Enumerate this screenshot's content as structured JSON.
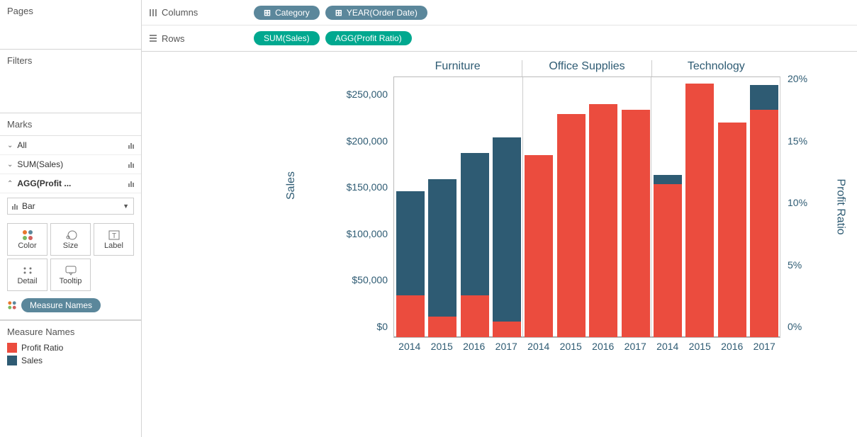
{
  "panels": {
    "pages_title": "Pages",
    "filters_title": "Filters",
    "marks_title": "Marks",
    "all_label": "All",
    "sum_sales_label": "SUM(Sales)",
    "agg_profit_label": "AGG(Profit ...",
    "mark_type": "Bar",
    "encodings": {
      "color": "Color",
      "size": "Size",
      "label": "Label",
      "detail": "Detail",
      "tooltip": "Tooltip"
    },
    "measure_names_pill": "Measure Names",
    "measure_names_title": "Measure Names",
    "legend_profit": "Profit Ratio",
    "legend_sales": "Sales"
  },
  "shelves": {
    "columns_label": "Columns",
    "rows_label": "Rows",
    "column_pills": [
      "Category",
      "YEAR(Order Date)"
    ],
    "row_pills": [
      "SUM(Sales)",
      "AGG(Profit Ratio)"
    ]
  },
  "colors": {
    "sales": "#2e5b73",
    "profit": "#eb4c3e"
  },
  "chart_data": {
    "type": "bar",
    "categories": [
      "Furniture",
      "Office Supplies",
      "Technology"
    ],
    "years": [
      "2014",
      "2015",
      "2016",
      "2017"
    ],
    "y_left_label": "Sales",
    "y_right_label": "Profit Ratio",
    "y_left_ticks": [
      0,
      50000,
      100000,
      150000,
      200000,
      250000
    ],
    "y_left_tick_labels": [
      "$0",
      "$50,000",
      "$100,000",
      "$150,000",
      "$200,000",
      "$250,000"
    ],
    "y_right_ticks": [
      0,
      5,
      10,
      15,
      20
    ],
    "y_right_tick_labels": [
      "0%",
      "5%",
      "10%",
      "15%",
      "20%"
    ],
    "y_left_max": 280000,
    "y_right_max": 21,
    "series": [
      {
        "name": "Sales",
        "axis": "left",
        "data": {
          "Furniture": {
            "2014": 157000,
            "2015": 170000,
            "2016": 198000,
            "2017": 215000
          },
          "Office Supplies": {
            "2014": 0,
            "2015": 0,
            "2016": 0,
            "2017": 0
          },
          "Technology": {
            "2014": 175000,
            "2015": 0,
            "2016": 0,
            "2017": 272000
          }
        },
        "note": "Dark bars; where bar not visible behind red, sales equals profit-ratio bar height visually (drawn underneath)"
      },
      {
        "name": "Profit Ratio",
        "axis": "right",
        "data": {
          "Furniture": {
            "2014": 3.5,
            "2015": 1.8,
            "2016": 3.4,
            "2017": 1.4
          },
          "Office Supplies": {
            "2014": 14.7,
            "2015": 18.0,
            "2016": 18.8,
            "2017": 18.4
          },
          "Technology": {
            "2014": 12.5,
            "2015": 20.5,
            "2016": 17.4,
            "2017": 18.4
          }
        }
      }
    ],
    "visual_bars": [
      {
        "cat": "Furniture",
        "year": "2014",
        "sales_h": 157000,
        "profit_h": 45000
      },
      {
        "cat": "Furniture",
        "year": "2015",
        "sales_h": 170000,
        "profit_h": 22000
      },
      {
        "cat": "Furniture",
        "year": "2016",
        "sales_h": 198000,
        "profit_h": 45000
      },
      {
        "cat": "Furniture",
        "year": "2017",
        "sales_h": 215000,
        "profit_h": 17000
      },
      {
        "cat": "Office Supplies",
        "year": "2014",
        "sales_h": 196000,
        "profit_h": 196000
      },
      {
        "cat": "Office Supplies",
        "year": "2015",
        "sales_h": 240000,
        "profit_h": 240000
      },
      {
        "cat": "Office Supplies",
        "year": "2016",
        "sales_h": 251000,
        "profit_h": 251000
      },
      {
        "cat": "Office Supplies",
        "year": "2017",
        "sales_h": 245000,
        "profit_h": 245000
      },
      {
        "cat": "Technology",
        "year": "2014",
        "sales_h": 175000,
        "profit_h": 165000
      },
      {
        "cat": "Technology",
        "year": "2015",
        "sales_h": 273000,
        "profit_h": 273000
      },
      {
        "cat": "Technology",
        "year": "2016",
        "sales_h": 231000,
        "profit_h": 231000
      },
      {
        "cat": "Technology",
        "year": "2017",
        "sales_h": 272000,
        "profit_h": 245000
      }
    ]
  }
}
